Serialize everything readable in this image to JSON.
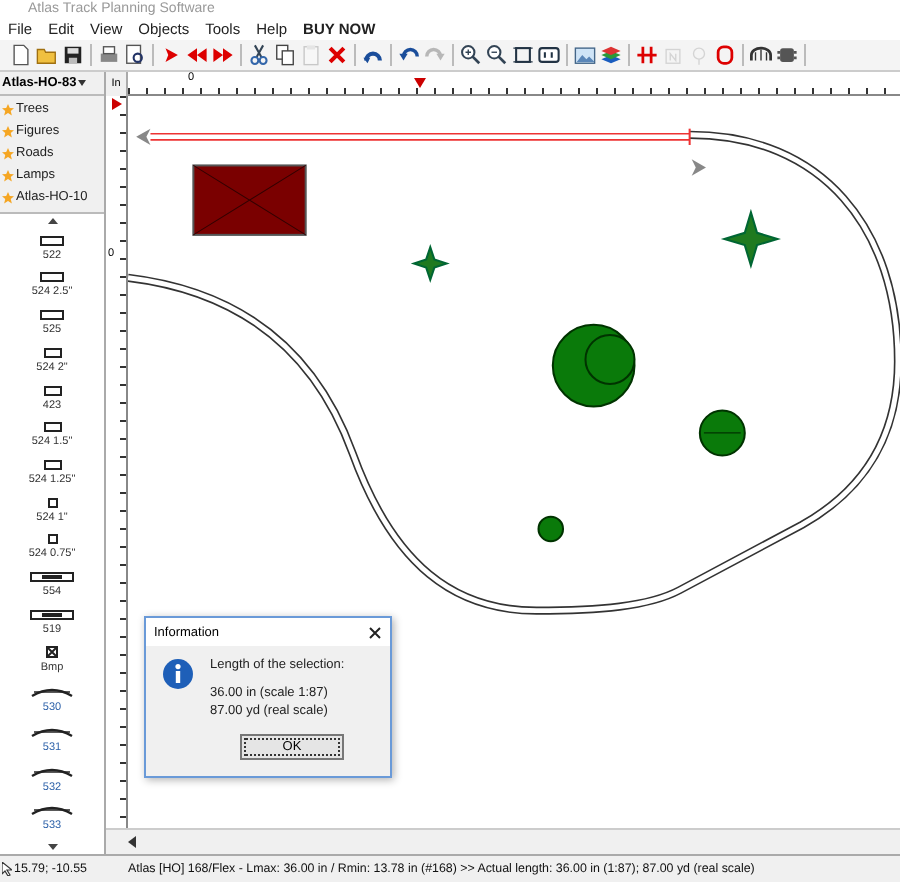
{
  "window": {
    "title": "Atlas Track Planning Software"
  },
  "menu": [
    {
      "label": "File",
      "kind": "plain"
    },
    {
      "label": "Edit",
      "kind": "plain"
    },
    {
      "label": "View",
      "kind": "plain"
    },
    {
      "label": "Objects",
      "kind": "plain"
    },
    {
      "label": "Tools",
      "kind": "plain"
    },
    {
      "label": "Help",
      "kind": "plain"
    },
    {
      "label": "BUY NOW",
      "kind": "promo"
    }
  ],
  "toolbar_groups": [
    {
      "tools": [
        {
          "kind": "new",
          "disabled": false
        },
        {
          "kind": "open",
          "disabled": false
        },
        {
          "kind": "save",
          "disabled": false
        }
      ]
    },
    {
      "tools": [
        {
          "kind": "print",
          "disabled": false
        },
        {
          "kind": "preview",
          "disabled": false
        }
      ]
    },
    {
      "tools": [
        {
          "kind": "play",
          "disabled": false
        },
        {
          "kind": "rewind",
          "disabled": false
        },
        {
          "kind": "forward",
          "disabled": false
        }
      ]
    },
    {
      "tools": [
        {
          "kind": "cut",
          "disabled": false
        },
        {
          "kind": "copy",
          "disabled": false
        },
        {
          "kind": "paste",
          "disabled": true
        },
        {
          "kind": "delete",
          "disabled": false
        }
      ]
    },
    {
      "tools": [
        {
          "kind": "rotate",
          "disabled": false
        }
      ]
    },
    {
      "tools": [
        {
          "kind": "undo",
          "disabled": false
        },
        {
          "kind": "redo",
          "disabled": true
        }
      ]
    },
    {
      "tools": [
        {
          "kind": "zoom-in",
          "disabled": false
        },
        {
          "kind": "zoom-out",
          "disabled": false
        },
        {
          "kind": "fit",
          "disabled": false
        },
        {
          "kind": "view",
          "disabled": false
        }
      ]
    },
    {
      "tools": [
        {
          "kind": "image",
          "disabled": false
        },
        {
          "kind": "layers",
          "disabled": false
        }
      ]
    },
    {
      "tools": [
        {
          "kind": "split",
          "disabled": false
        },
        {
          "kind": "label",
          "disabled": true
        },
        {
          "kind": "pin",
          "disabled": true
        },
        {
          "kind": "ring",
          "disabled": false
        }
      ]
    },
    {
      "tools": [
        {
          "kind": "arch",
          "disabled": false
        },
        {
          "kind": "loco",
          "disabled": false
        }
      ]
    }
  ],
  "library": {
    "selector": "Atlas-HO-83",
    "categories": [
      "Trees",
      "Figures",
      "Roads",
      "Lamps",
      "Atlas-HO-10"
    ],
    "parts": [
      {
        "label": "522",
        "kind": "straight"
      },
      {
        "label": "524 2.5\"",
        "kind": "straight"
      },
      {
        "label": "525",
        "kind": "straight"
      },
      {
        "label": "524 2\"",
        "kind": "short"
      },
      {
        "label": "423",
        "kind": "short"
      },
      {
        "label": "524 1.5\"",
        "kind": "short"
      },
      {
        "label": "524 1.25\"",
        "kind": "short"
      },
      {
        "label": "524 1\"",
        "kind": "tiny"
      },
      {
        "label": "524 0.75\"",
        "kind": "tiny"
      },
      {
        "label": "554",
        "kind": "long"
      },
      {
        "label": "519",
        "kind": "long"
      },
      {
        "label": "Bmp",
        "kind": "bumper"
      },
      {
        "label": "530",
        "kind": "curve"
      },
      {
        "label": "531",
        "kind": "curve"
      },
      {
        "label": "532",
        "kind": "curve"
      },
      {
        "label": "533",
        "kind": "curve"
      }
    ]
  },
  "rulers": {
    "unit": "In",
    "top_label": "0",
    "left_label": "0"
  },
  "dialog": {
    "title": "Information",
    "heading": "Length of the selection:",
    "lines": [
      "36.00 in (scale 1:87)",
      "87.00 yd (real scale)"
    ],
    "button": "OK"
  },
  "status_bar": {
    "coordinates": "15.79; -10.55",
    "message": "Atlas [HO] 168/Flex - Lmax: 36.00 in / Rmin: 13.78 in (#168)  >>  Actual length: 36.00 in (1:87); 87.00 yd (real scale)"
  }
}
